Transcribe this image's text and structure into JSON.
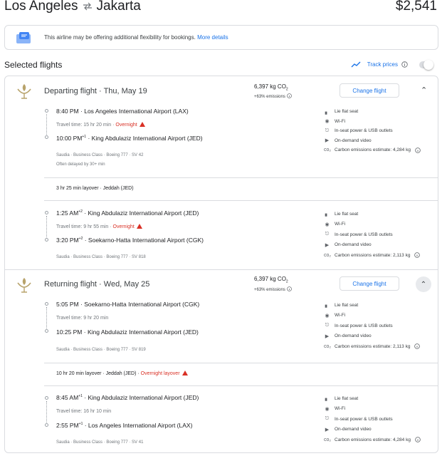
{
  "header": {
    "origin": "Los Angeles",
    "destination": "Jakarta",
    "swap_icon": "swap-arrows-icon",
    "price": "$2,541"
  },
  "notice": {
    "text": "This airline may be offering additional flexibility for bookings.",
    "link": "More details"
  },
  "selected": {
    "title": "Selected flights",
    "track_label": "Track prices"
  },
  "departing": {
    "title": "Departing flight · Thu, May 19",
    "co2_value": "6,397 kg CO",
    "co2_sub": "2",
    "co2_delta": "+63% emissions",
    "change_label": "Change flight",
    "legs": [
      {
        "dep_time": "8:40 PM",
        "dep_day": "",
        "dep_airport": "Los Angeles International Airport (LAX)",
        "travel": "Travel time: 15 hr 20 min",
        "overnight": "Overnight",
        "arr_time": "10:00 PM",
        "arr_day": "+1",
        "arr_airport": "King Abdulaziz International Airport (JED)",
        "meta": "Saudia · Business Class · Boeing 777 · SV 42",
        "delay": "Often delayed by 30+ min",
        "amenities": [
          "Lie flat seat",
          "Wi-Fi",
          "In-seat power & USB outlets",
          "On-demand video",
          "Carbon emissions estimate: 4,284 kg"
        ]
      },
      {
        "dep_time": "1:25 AM",
        "dep_day": "+2",
        "dep_airport": "King Abdulaziz International Airport (JED)",
        "travel": "Travel time: 9 hr 55 min",
        "overnight": "Overnight",
        "arr_time": "3:20 PM",
        "arr_day": "+2",
        "arr_airport": "Soekarno-Hatta International Airport (CGK)",
        "meta": "Saudia · Business Class · Boeing 777 · SV 818",
        "amenities": [
          "Lie flat seat",
          "Wi-Fi",
          "In-seat power & USB outlets",
          "On-demand video",
          "Carbon emissions estimate: 2,113 kg"
        ]
      }
    ],
    "layover": "3 hr 25 min layover · Jeddah (JED)"
  },
  "returning": {
    "title": "Returning flight · Wed, May 25",
    "co2_value": "6,397 kg CO",
    "co2_sub": "2",
    "co2_delta": "+63% emissions",
    "change_label": "Change flight",
    "legs": [
      {
        "dep_time": "5:05 PM",
        "dep_day": "",
        "dep_airport": "Soekarno-Hatta International Airport (CGK)",
        "travel": "Travel time: 9 hr 20 min",
        "arr_time": "10:25 PM",
        "arr_day": "",
        "arr_airport": "King Abdulaziz International Airport (JED)",
        "meta": "Saudia · Business Class · Boeing 777 · SV 819",
        "amenities": [
          "Lie flat seat",
          "Wi-Fi",
          "In-seat power & USB outlets",
          "On-demand video",
          "Carbon emissions estimate: 2,113 kg"
        ]
      },
      {
        "dep_time": "8:45 AM",
        "dep_day": "+1",
        "dep_airport": "King Abdulaziz International Airport (JED)",
        "travel": "Travel time: 16 hr 10 min",
        "arr_time": "2:55 PM",
        "arr_day": "+1",
        "arr_airport": "Los Angeles International Airport (LAX)",
        "meta": "Saudia · Business Class · Boeing 777 · SV 41",
        "amenities": [
          "Lie flat seat",
          "Wi-Fi",
          "In-seat power & USB outlets",
          "On-demand video",
          "Carbon emissions estimate: 4,284 kg"
        ]
      }
    ],
    "layover": "10 hr 20 min layover · Jeddah (JED)",
    "layover_overnight": "Overnight layover"
  },
  "colors": {
    "accent": "#1a73e8",
    "warning": "#d93025",
    "border": "#dadce0",
    "airline_gold": "#b8a36b"
  }
}
